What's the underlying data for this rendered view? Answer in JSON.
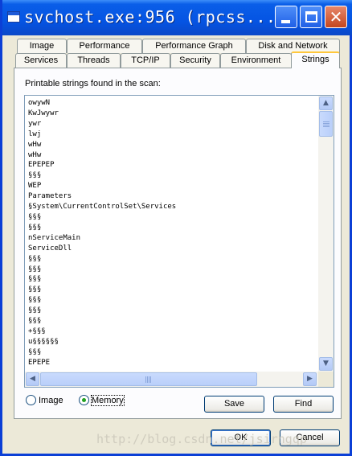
{
  "window": {
    "title": "svchost.exe:956 (rpcss..."
  },
  "tabs_back_row": [
    "Image",
    "Performance",
    "Performance Graph",
    "Disk and Network"
  ],
  "tabs_front_row": [
    "Services",
    "Threads",
    "TCP/IP",
    "Security",
    "Environment",
    "Strings"
  ],
  "active_tab": "Strings",
  "strings_panel": {
    "label": "Printable strings found in the scan:",
    "lines": [
      "owywN",
      "KwJwywr",
      "ywr",
      "lwj",
      "wHw",
      "wHw",
      "EPEPEP",
      "§§§",
      "WEP",
      "Parameters",
      "§System\\CurrentControlSet\\Services",
      "§§§",
      "§§§",
      "nServiceMain",
      "ServiceDll",
      "§§§",
      "§§§",
      "§§§",
      "§§§",
      "§§§",
      "§§§",
      "§§§",
      "+§§§",
      "u§§§§§§",
      "§§§",
      "EPEPE"
    ]
  },
  "scan_mode": {
    "options": [
      "Image",
      "Memory"
    ],
    "selected": "Memory"
  },
  "buttons": {
    "save": "Save",
    "find": "Find",
    "ok": "OK",
    "cancel": "Cancel"
  },
  "watermark": "http://blog.csdn.net/jsirngqp",
  "colors": {
    "titlebar": "#0554e3",
    "dialog_background": "#ece9d8",
    "active_tab_highlight": "#ffc73c",
    "radio_selected": "#21a121"
  },
  "icons": [
    "window-icon",
    "minimize-icon",
    "maximize-icon",
    "close-icon",
    "scroll-up-icon",
    "scroll-down-icon",
    "scroll-left-icon",
    "scroll-right-icon"
  ]
}
